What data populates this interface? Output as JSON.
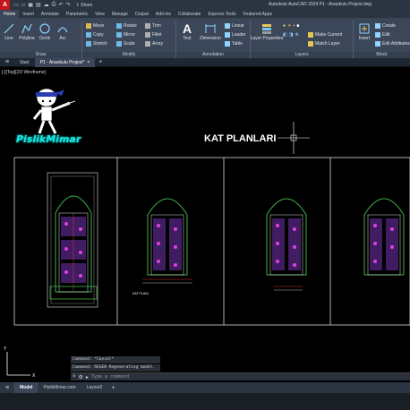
{
  "titlebar": {
    "logo": "A",
    "share": "Share",
    "title": "Autodesk AutoCAD 2024   P1 - Anaokulu Projesi.dwg"
  },
  "ribbon_tabs": [
    "Home",
    "Insert",
    "Annotate",
    "Parametric",
    "View",
    "Manage",
    "Output",
    "Add-ins",
    "Collaborate",
    "Express Tools",
    "Featured Apps"
  ],
  "ribbon": {
    "draw": {
      "title": "Draw",
      "tools": [
        "Line",
        "Polyline",
        "Circle",
        "Arc"
      ]
    },
    "modify": {
      "title": "Modify",
      "tools": [
        "Move",
        "Rotate",
        "Trim",
        "Copy",
        "Mirror",
        "Fillet",
        "Stretch",
        "Scale",
        "Array"
      ]
    },
    "annotation": {
      "title": "Annotation",
      "tools": [
        "Text",
        "Dimension",
        "Linear",
        "Leader",
        "Table"
      ]
    },
    "layers": {
      "title": "Layers",
      "tools": [
        "Layer Properties",
        "Make Current",
        "Match Layer"
      ]
    },
    "block": {
      "title": "Block",
      "tools": [
        "Insert",
        "Create",
        "Edit",
        "Edit Attributes"
      ]
    }
  },
  "file_tabs": {
    "start": "Start",
    "active": "P1 - Anaokulu Projesi*"
  },
  "drawing": {
    "viewport_label": "[-][Top][2D Wireframe]",
    "brand": "PislikMimar",
    "plan_title": "KAT PLANLARI",
    "plan_label": "KAT PLANI"
  },
  "command": {
    "history": [
      "Command: *Cancel*",
      "Command: REGEN Regenerating model."
    ],
    "placeholder": "Type a command"
  },
  "layout_tabs": [
    "Model",
    "PislikMimar.com",
    "Layout2"
  ]
}
